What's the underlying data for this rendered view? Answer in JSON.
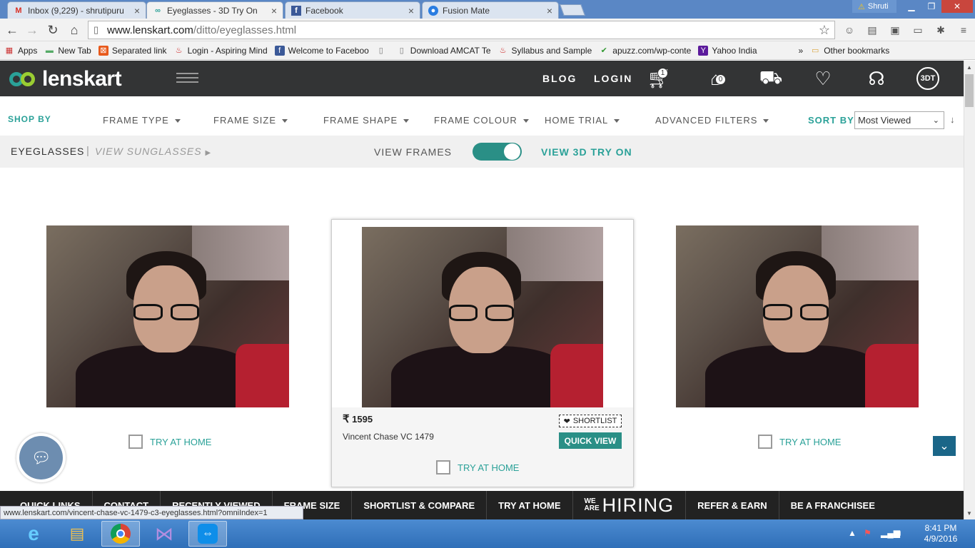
{
  "browser": {
    "tabs": [
      {
        "title": "Inbox (9,229) - shrutipuru",
        "icon": "gmail-icon",
        "active": false
      },
      {
        "title": "Eyeglasses - 3D Try On",
        "icon": "lenskart-icon",
        "active": true
      },
      {
        "title": "Facebook",
        "icon": "facebook-icon",
        "active": false
      },
      {
        "title": "Fusion Mate",
        "icon": "fusion-mate-icon",
        "active": false
      }
    ],
    "user": "Shruti",
    "url_host": "www.lenskart.com",
    "url_path": "/ditto/eyeglasses.html",
    "bookmarks": [
      {
        "label": "Apps",
        "icon": "apps-grid-icon"
      },
      {
        "label": "New Tab",
        "icon": "page-icon"
      },
      {
        "label": "Separated link",
        "icon": "link-icon"
      },
      {
        "label": "Login - Aspiring Mind",
        "icon": "aspiring-minds-icon"
      },
      {
        "label": "Welcome to Faceboo",
        "icon": "facebook-icon"
      },
      {
        "label": "",
        "icon": "page-icon"
      },
      {
        "label": "Download AMCAT Te",
        "icon": "page-icon"
      },
      {
        "label": "Syllabus and Sample",
        "icon": "aspiring-minds-icon"
      },
      {
        "label": "apuzz.com/wp-conte",
        "icon": "bookmark-check-icon"
      },
      {
        "label": "Yahoo India",
        "icon": "yahoo-icon"
      }
    ],
    "bookmarks_overflow": "»",
    "other_bookmarks": "Other bookmarks",
    "status_url": "www.lenskart.com/vincent-chase-vc-1479-c3-eyeglasses.html?omniIndex=1"
  },
  "site": {
    "logo": "lenskart",
    "nav": {
      "blog": "BLOG",
      "login": "LOGIN"
    },
    "cart_count": "1",
    "home_count": "0",
    "icon_3dt": "3DT"
  },
  "filters": {
    "shop_by": "SHOP BY",
    "items": [
      "FRAME TYPE",
      "FRAME SIZE",
      "FRAME SHAPE",
      "FRAME COLOUR",
      "HOME TRIAL",
      "ADVANCED FILTERS"
    ],
    "sort_by": "SORT BY",
    "sort_value": "Most Viewed"
  },
  "subbar": {
    "eyeglasses": "EYEGLASSES",
    "separator": "|",
    "view_sunglasses": "VIEW SUNGLASSES",
    "view_frames": "VIEW FRAMES",
    "view_3d": "VIEW 3D TRY ON"
  },
  "products": {
    "try_at_home": "TRY AT HOME",
    "featured": {
      "currency": "₹",
      "price": "1595",
      "name": "Vincent Chase VC 1479",
      "shortlist": "SHORTLIST",
      "quick_view": "QUICK VIEW"
    }
  },
  "footer": {
    "links": [
      "QUICK LINKS",
      "CONTACT",
      "RECENTLY VIEWED",
      "FRAME SIZE",
      "SHORTLIST & COMPARE",
      "TRY AT HOME"
    ],
    "hiring_small_1": "WE",
    "hiring_small_2": "ARE",
    "hiring_big": "HIRING",
    "links2": [
      "REFER & EARN",
      "BE A FRANCHISEE"
    ]
  },
  "taskbar": {
    "time": "8:41 PM",
    "date": "4/9/2016",
    "apps": [
      "internet-explorer-icon",
      "file-explorer-icon",
      "chrome-icon",
      "visual-studio-icon",
      "teamviewer-icon"
    ]
  },
  "colors": {
    "teal": "#2aa198",
    "header_dark": "#333435",
    "quick_view": "#2a8f86"
  }
}
